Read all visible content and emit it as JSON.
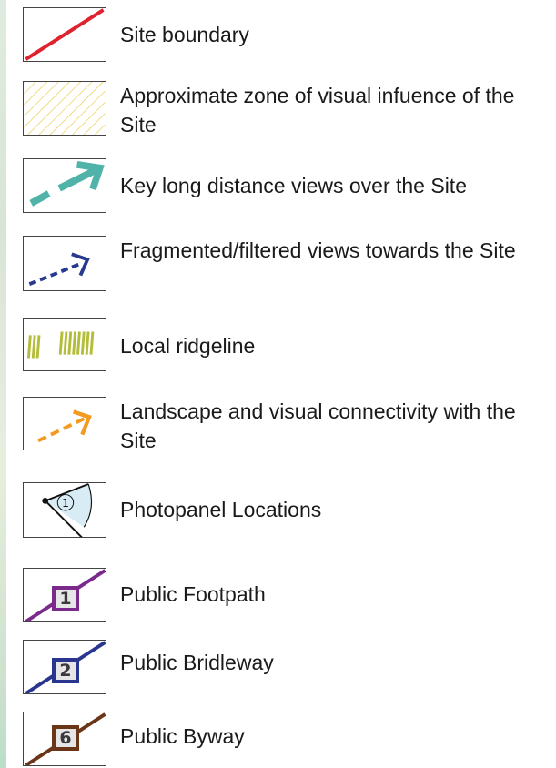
{
  "legend": {
    "items": [
      {
        "label": "Site boundary",
        "symbol": "site-boundary",
        "color": "#e0212e"
      },
      {
        "label": "Approximate zone of visual infuence of the Site",
        "symbol": "visual-influence-zone",
        "color": "#e9cc4e"
      },
      {
        "label": "Key long distance views over the Site",
        "symbol": "long-distance-view-arrow",
        "color": "#4fb3a9"
      },
      {
        "label": "Fragmented/filtered views towards the Site",
        "symbol": "filtered-view-arrow",
        "color": "#283a8f"
      },
      {
        "label": "Local ridgeline",
        "symbol": "ridgeline-hatch",
        "color": "#b4bd3a"
      },
      {
        "label": "Landscape and visual connectivity with the Site",
        "symbol": "connectivity-arrow",
        "color": "#f39a21"
      },
      {
        "label": "Photopanel Locations",
        "symbol": "photopanel-marker",
        "marker_number": "1",
        "color": "#d8ecf5"
      },
      {
        "label": "Public Footpath",
        "symbol": "footpath-line",
        "badge": "1",
        "color": "#7b2a8c"
      },
      {
        "label": "Public Bridleway",
        "symbol": "bridleway-line",
        "badge": "2",
        "color": "#2a3590"
      },
      {
        "label": "Public Byway",
        "symbol": "byway-line",
        "badge": "6",
        "color": "#6b3518"
      }
    ]
  }
}
